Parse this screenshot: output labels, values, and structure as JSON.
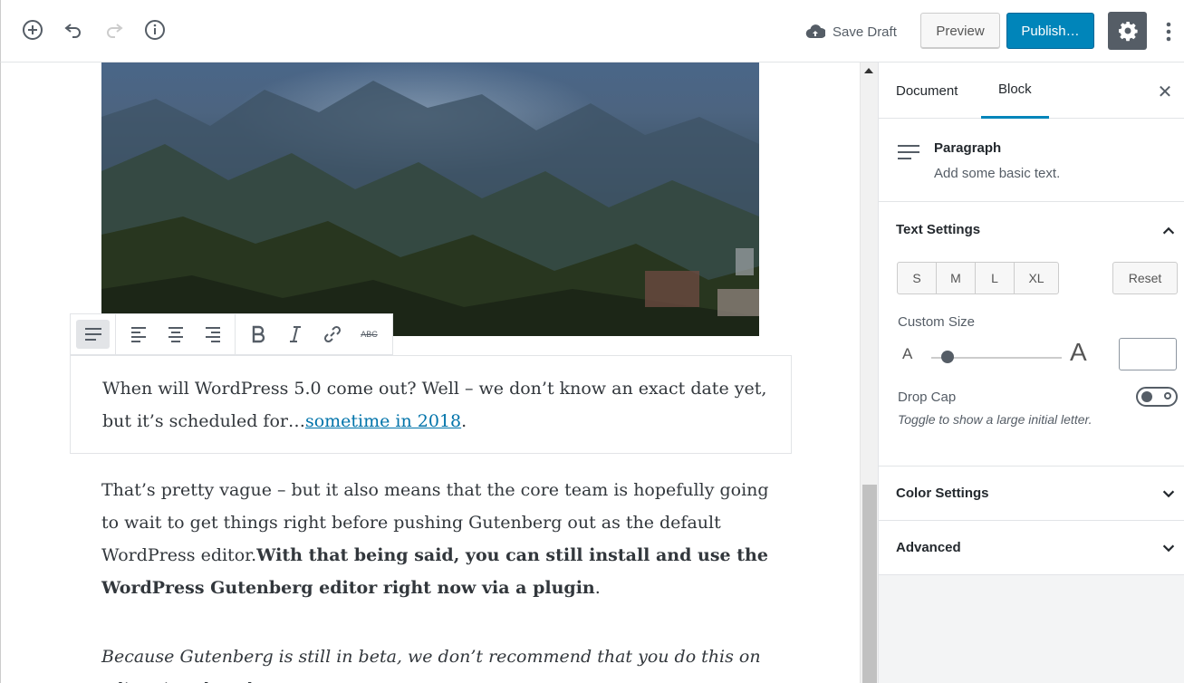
{
  "toolbar": {
    "save_draft_label": "Save Draft",
    "preview_label": "Preview",
    "publish_label": "Publish…"
  },
  "icons": {
    "add": "add-block-icon",
    "undo": "undo-icon",
    "redo": "redo-icon",
    "info": "info-icon",
    "cloud": "cloud-upload-icon",
    "settings": "gear-icon",
    "more": "more-vertical-icon"
  },
  "colors": {
    "accent": "#0085ba",
    "link": "#0073aa",
    "dark": "#555d66"
  },
  "editor": {
    "paragraph1_text": "When will WordPress 5.0 come out? Well – we don’t know an exact date yet, but it’s scheduled for…",
    "paragraph1_link": "sometime in 2018",
    "paragraph1_end": ".",
    "paragraph2_text": "That’s pretty vague – but it also means that the core team is hopefully going to wait to get things right before pushing Gutenberg out as the default WordPress editor.",
    "paragraph2_bold": "With that being said, you can still install and use the WordPress Gutenberg editor right now via a plugin",
    "paragraph2_end": ".",
    "paragraph3_text": "Because Gutenberg is still in beta, we don’t recommend that you do this on a live site, though."
  },
  "block_toolbar": {
    "tools": [
      "paragraph-icon",
      "align-left-icon",
      "align-center-icon",
      "align-right-icon",
      "bold-icon",
      "italic-icon",
      "link-icon",
      "strikethrough-icon"
    ],
    "strikethrough_glyph": "ABC"
  },
  "sidebar": {
    "tabs": [
      {
        "label": "Document",
        "active": false
      },
      {
        "label": "Block",
        "active": true
      }
    ],
    "close_glyph": "✕",
    "block": {
      "title": "Paragraph",
      "description": "Add some basic text."
    },
    "text_settings": {
      "title": "Text Settings",
      "sizes": [
        "S",
        "M",
        "L",
        "XL"
      ],
      "reset_label": "Reset",
      "custom_size_label": "Custom Size",
      "range_small_glyph": "A",
      "range_big_glyph": "A",
      "custom_size_value": "",
      "drop_cap_label": "Drop Cap",
      "drop_cap_on": false,
      "drop_cap_help": "Toggle to show a large initial letter."
    },
    "color_settings": {
      "title": "Color Settings"
    },
    "advanced": {
      "title": "Advanced"
    }
  }
}
